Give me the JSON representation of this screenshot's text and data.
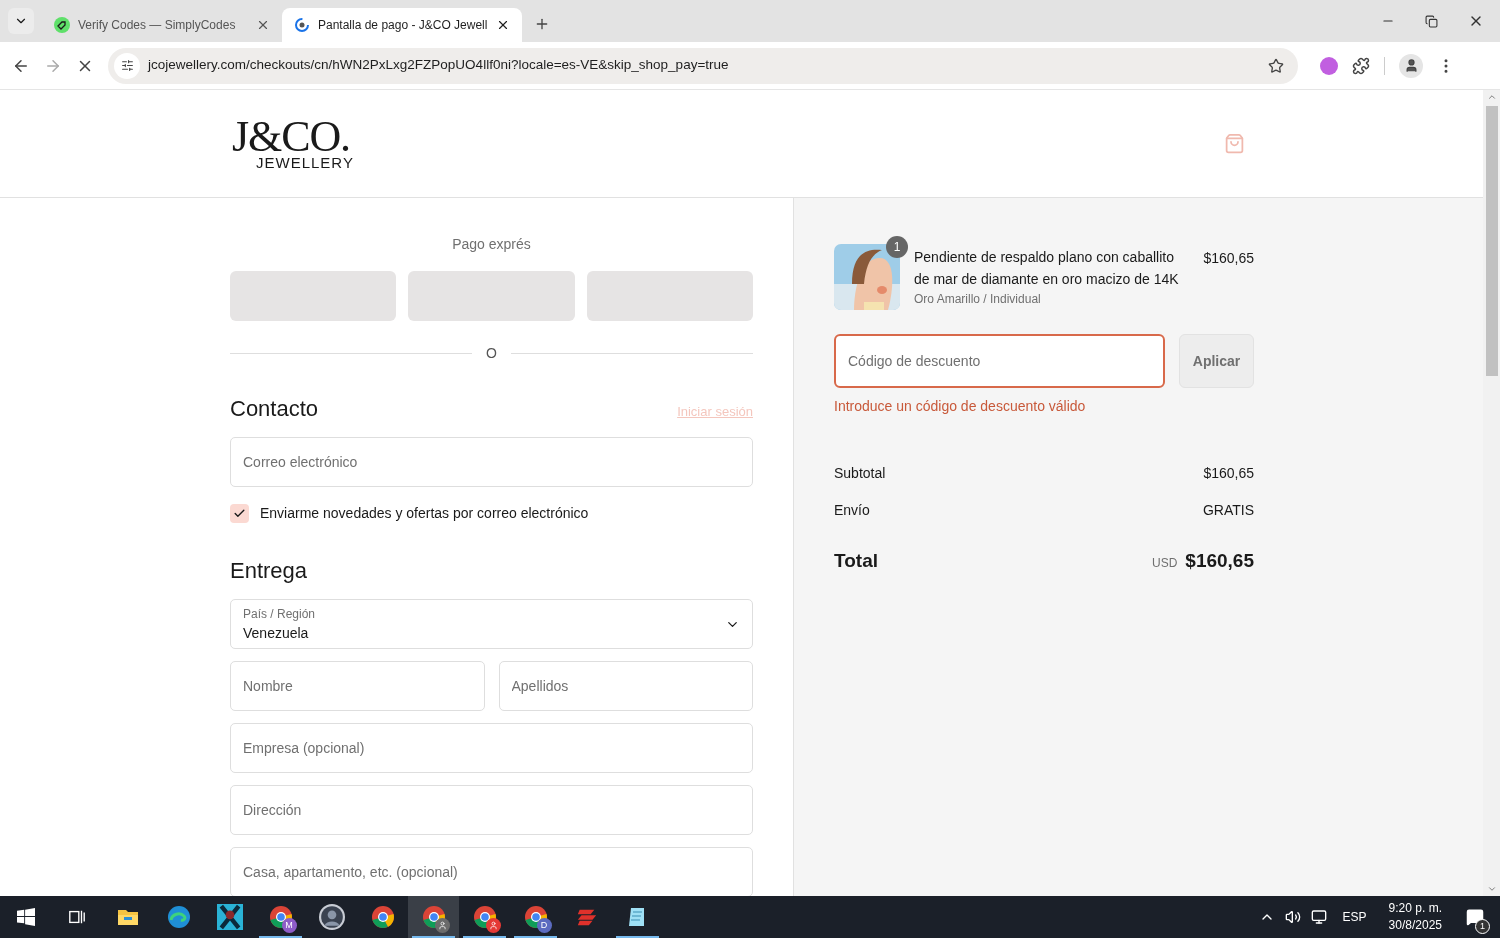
{
  "browser": {
    "tabs": [
      {
        "title": "Verify Codes — SimplyCodes",
        "selected": false
      },
      {
        "title": "Pantalla de pago - J&CO Jewell",
        "selected": true
      }
    ],
    "url": "jcojewellery.com/checkouts/cn/hWN2PxLxg2FZPopUO4llf0ni?locale=es-VE&skip_shop_pay=true",
    "loading": true
  },
  "header": {
    "logo": {
      "mark": "J&CO.",
      "subtitle": "JEWELLERY"
    }
  },
  "express_checkout": {
    "title": "Pago exprés",
    "buttons": [
      {
        "kind": "skeleton"
      },
      {
        "kind": "skeleton"
      },
      {
        "kind": "skeleton"
      }
    ],
    "divider": "O"
  },
  "contact": {
    "title": "Contacto",
    "login_link": "Iniciar sesión",
    "email": {
      "placeholder": "Correo electrónico"
    },
    "newsletter": {
      "label": "Enviarme novedades y ofertas por correo electrónico",
      "checked": true
    }
  },
  "delivery": {
    "title": "Entrega",
    "country": {
      "label": "País / Región",
      "value": "Venezuela"
    },
    "rows": [
      [
        {
          "placeholder": "Nombre"
        },
        {
          "placeholder": "Apellidos"
        }
      ],
      [
        {
          "placeholder": "Empresa (opcional)"
        }
      ],
      [
        {
          "placeholder": "Dirección"
        }
      ],
      [
        {
          "placeholder": "Casa, apartamento, etc. (opcional)"
        }
      ]
    ]
  },
  "summary": {
    "items": [
      {
        "name": "Pendiente de respaldo plano con caballito de mar de diamante en oro macizo de 14K",
        "variant": "Oro Amarillo / Individual",
        "price": "$160,65",
        "quantity": "1"
      }
    ],
    "discount": {
      "placeholder": "Código de descuento",
      "error": true,
      "button": "Aplicar",
      "error_message": "Introduce un código de descuento válido"
    },
    "lines": [
      {
        "label": "Subtotal",
        "value": "$160,65"
      },
      {
        "label": "Envío",
        "value": "GRATIS"
      }
    ],
    "total": {
      "label": "Total",
      "currency": "USD",
      "value": "$160,65"
    }
  },
  "taskbar": {
    "apps": [
      {
        "kind": "start",
        "running": false,
        "selected": false
      },
      {
        "kind": "taskview",
        "running": false,
        "selected": false
      },
      {
        "kind": "explorer",
        "running": false,
        "selected": false
      },
      {
        "kind": "edge",
        "running": false,
        "selected": false
      },
      {
        "kind": "game",
        "running": false,
        "selected": false
      },
      {
        "kind": "chrome",
        "badge": "M",
        "color": "#8e5cc8",
        "running": true,
        "selected": false
      },
      {
        "kind": "avatar",
        "running": false,
        "selected": false
      },
      {
        "kind": "chrome",
        "running": false,
        "selected": false
      },
      {
        "kind": "chrome-user",
        "color": "#6b6b6b",
        "running": true,
        "selected": true
      },
      {
        "kind": "chrome-user",
        "color": "#e53935",
        "running": true,
        "selected": false
      },
      {
        "kind": "chrome",
        "badge": "D",
        "color": "#5c6bc0",
        "running": true,
        "selected": false
      },
      {
        "kind": "redapp",
        "running": false,
        "selected": false
      },
      {
        "kind": "notepad",
        "running": true,
        "selected": false
      }
    ],
    "tray": {
      "language": "ESP",
      "time": "9:20 p. m.",
      "date": "30/8/2025",
      "notifications": "1"
    }
  }
}
